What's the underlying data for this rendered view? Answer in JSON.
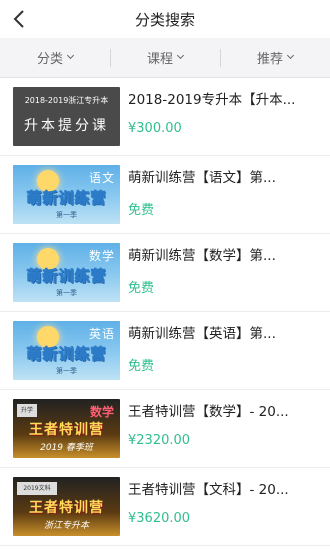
{
  "header": {
    "title": "分类搜索"
  },
  "filters": [
    {
      "label": "分类"
    },
    {
      "label": "课程"
    },
    {
      "label": "推荐"
    }
  ],
  "courses": [
    {
      "title": "2018-2019专升本【升本...",
      "price": "¥300.00",
      "thumb": {
        "line1": "2018-2019浙江专升本",
        "line2": "升本提分课"
      }
    },
    {
      "title": "萌新训练营【语文】第...",
      "price": "免费",
      "thumb": {
        "subject": "语文",
        "logo": "萌新训练营",
        "season": "第一季"
      }
    },
    {
      "title": "萌新训练营【数学】第...",
      "price": "免费",
      "thumb": {
        "subject": "数学",
        "logo": "萌新训练营",
        "season": "第一季"
      }
    },
    {
      "title": "萌新训练营【英语】第...",
      "price": "免费",
      "thumb": {
        "subject": "英语",
        "logo": "萌新训练营",
        "season": "第一季"
      }
    },
    {
      "title": "王者特训营【数学】- 20...",
      "price": "¥2320.00",
      "thumb": {
        "badge": "升学",
        "subject": "数学",
        "logo": "王者特训营",
        "season": "2019 春季班"
      }
    },
    {
      "title": "王者特训营【文科】- 20...",
      "price": "¥3620.00",
      "thumb": {
        "badge": "2019文科",
        "subject": "",
        "logo": "王者特训营",
        "season": "浙江专升本"
      }
    }
  ],
  "colors": {
    "price": "#2fbf8c",
    "filter_bg": "#f4f4f6"
  },
  "icons": {
    "back": "chevron-left-icon",
    "filter_arrow": "chevron-down-icon"
  }
}
